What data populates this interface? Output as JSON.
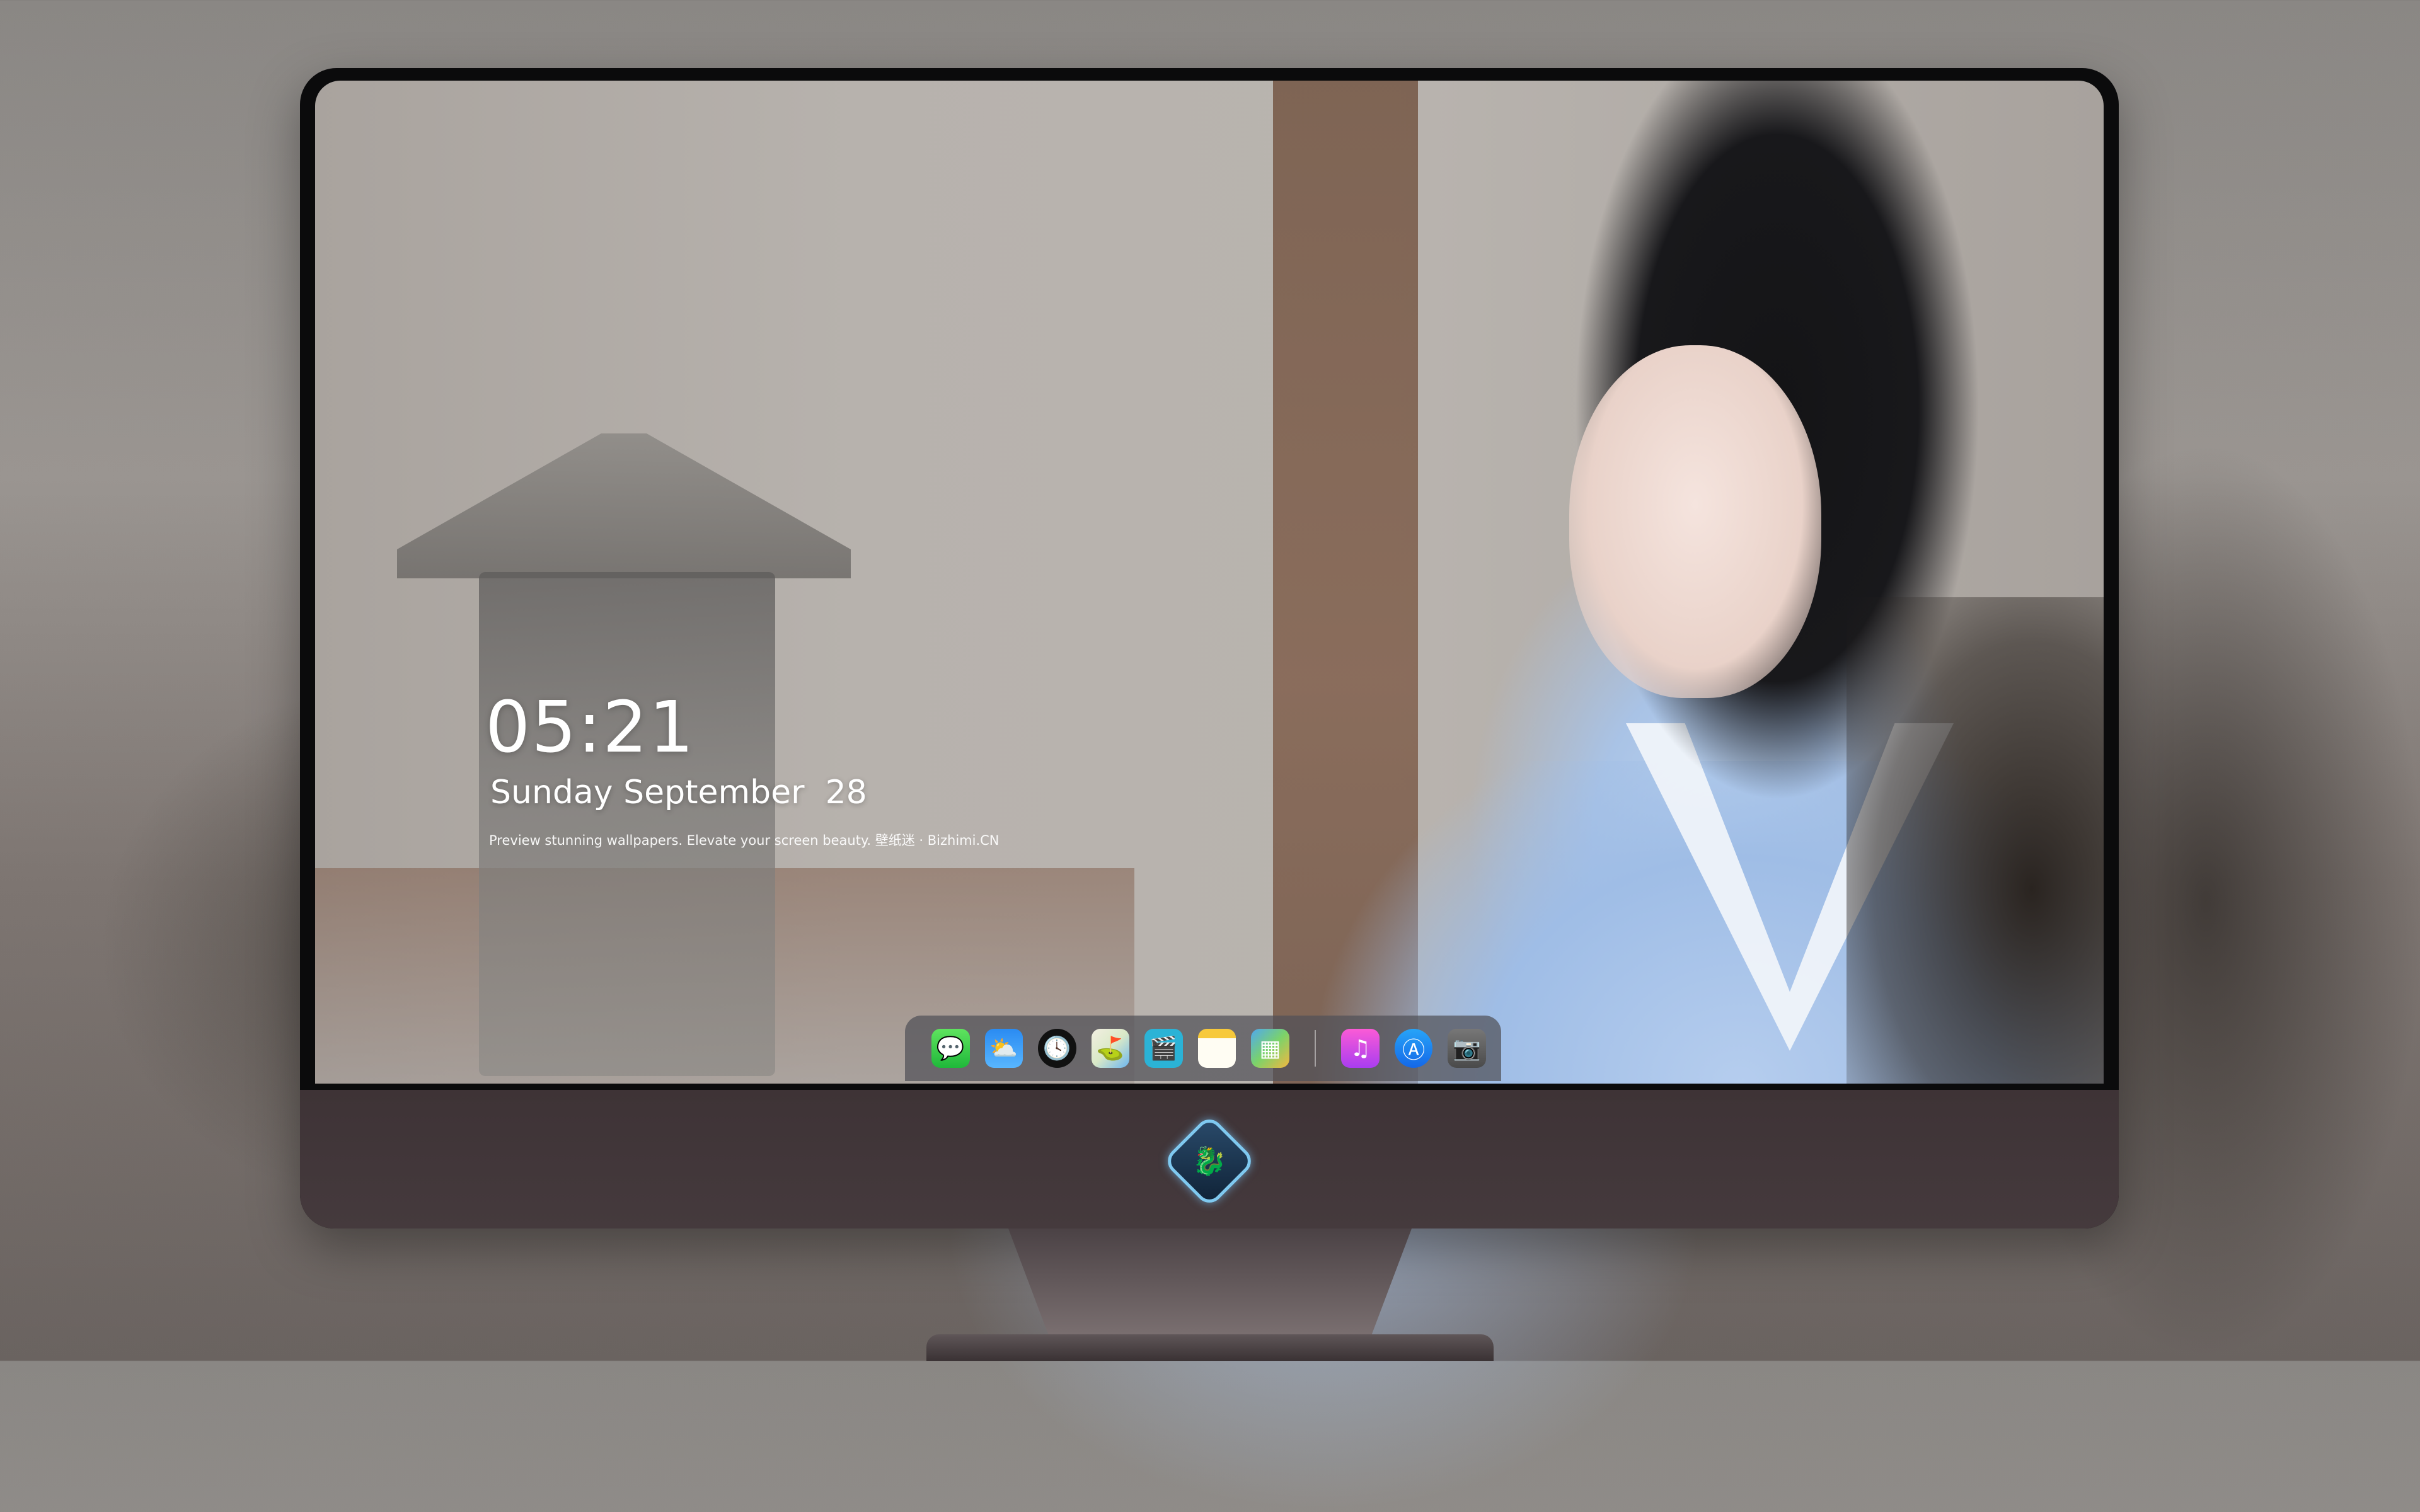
{
  "lock_screen": {
    "time": "05:21",
    "date": "Sunday September  28",
    "tagline": "Preview stunning wallpapers. Elevate your screen beauty. 壁纸迷 · Bizhimi.CN"
  },
  "dock": {
    "apps": [
      {
        "name": "messages",
        "icon": "message-bubble-icon",
        "glyph": "💬"
      },
      {
        "name": "weather",
        "icon": "cloud-sun-icon",
        "glyph": "⛅"
      },
      {
        "name": "clock",
        "icon": "clock-icon",
        "glyph": "🕓"
      },
      {
        "name": "maps",
        "icon": "map-icon",
        "glyph": "⛳"
      },
      {
        "name": "videos",
        "icon": "clapperboard-icon",
        "glyph": "🎬"
      },
      {
        "name": "notes",
        "icon": "notepad-icon",
        "glyph": ""
      },
      {
        "name": "photos",
        "icon": "photo-gallery-icon",
        "glyph": "▦"
      },
      {
        "name": "music",
        "icon": "music-note-icon",
        "glyph": "♫"
      },
      {
        "name": "app-store",
        "icon": "app-store-icon",
        "glyph": "Ⓐ"
      },
      {
        "name": "camera",
        "icon": "camera-icon",
        "glyph": "📷"
      }
    ]
  },
  "monitor": {
    "logo_icon": "dragon-mascot-icon",
    "logo_glyph": "🐉"
  },
  "colors": {
    "bezel": "#0b0b0c",
    "chin": "#413538",
    "dock_bg": "rgba(80,80,88,0.72)"
  }
}
